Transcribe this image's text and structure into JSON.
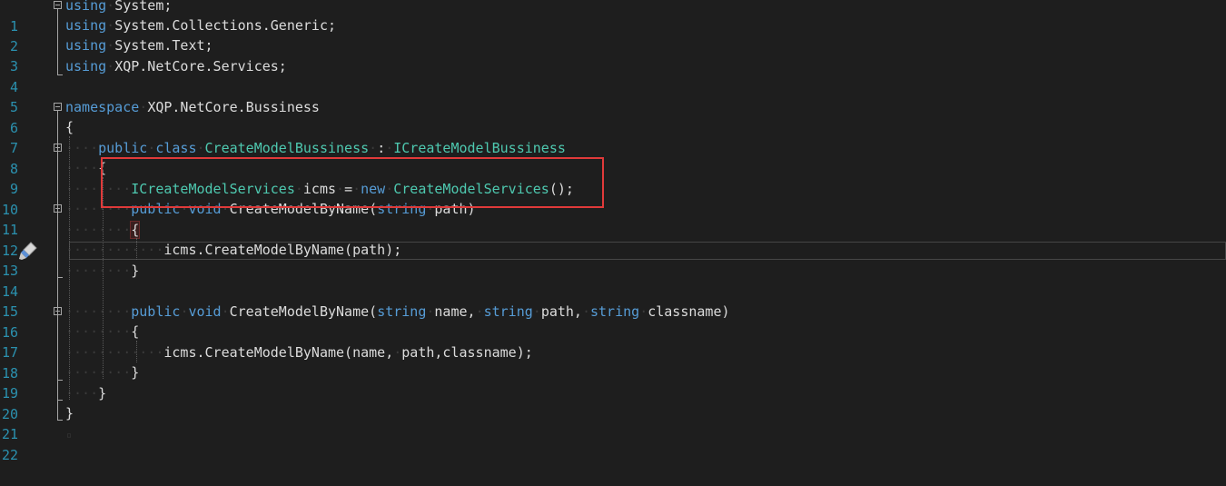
{
  "editor": {
    "lines": [
      {
        "num": "1",
        "code": "using System;"
      },
      {
        "num": "2",
        "code": "using System.Collections.Generic;"
      },
      {
        "num": "3",
        "code": "using System.Text;"
      },
      {
        "num": "4",
        "code": "using XQP.NetCore.Services;"
      },
      {
        "num": "5",
        "code": ""
      },
      {
        "num": "6",
        "code": "namespace XQP.NetCore.Bussiness"
      },
      {
        "num": "7",
        "code": "{"
      },
      {
        "num": "8",
        "code": "    public class CreateModelBussiness : ICreateModelBussiness"
      },
      {
        "num": "9",
        "code": "    {"
      },
      {
        "num": "10",
        "code": "        ICreateModelServices icms = new CreateModelServices();"
      },
      {
        "num": "11",
        "code": "        public void CreateModelByName(string path)"
      },
      {
        "num": "12",
        "code": "        {"
      },
      {
        "num": "13",
        "code": "            icms.CreateModelByName(path);"
      },
      {
        "num": "14",
        "code": "        }"
      },
      {
        "num": "15",
        "code": ""
      },
      {
        "num": "16",
        "code": "        public void CreateModelByName(string name, string path, string classname)"
      },
      {
        "num": "17",
        "code": "        {"
      },
      {
        "num": "18",
        "code": "            icms.CreateModelByName(name, path,classname);"
      },
      {
        "num": "19",
        "code": "        }"
      },
      {
        "num": "20",
        "code": "    }"
      },
      {
        "num": "21",
        "code": "}"
      },
      {
        "num": "22",
        "code": ""
      }
    ],
    "colors": {
      "background": "#1e1e1e",
      "keyword": "#569cd6",
      "type": "#4ec9b0",
      "plain": "#dcdcdc",
      "line_number": "#2b91af",
      "highlight_box": "#e03a3a"
    },
    "gutter_icon": "quick-action-brush-icon"
  }
}
